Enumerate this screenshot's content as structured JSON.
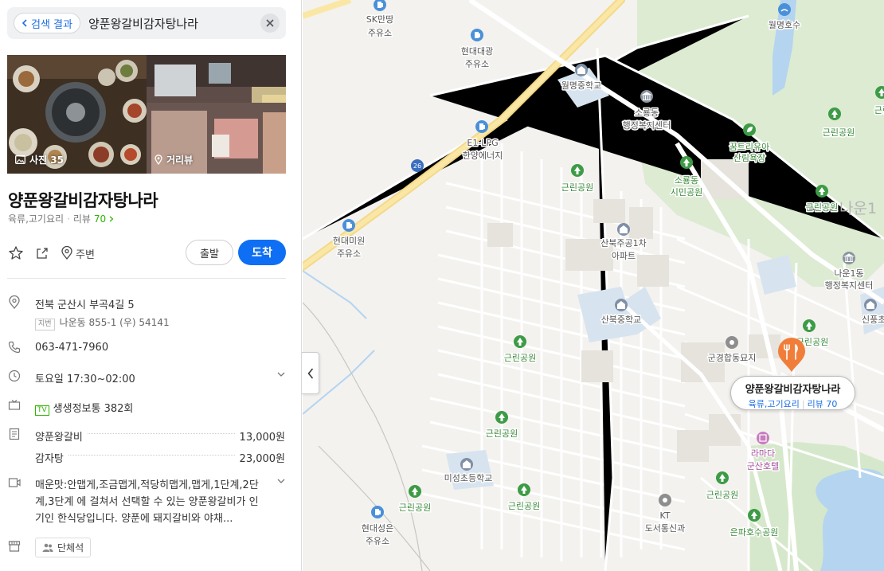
{
  "search": {
    "back_label": "검색 결과",
    "query": "양푼왕갈비감자탕나라"
  },
  "photos": {
    "photo_label": "사진 35",
    "street_label": "거리뷰"
  },
  "place": {
    "name": "양푼왕갈비감자탕나라",
    "category": "육류,고기요리",
    "review_label": "리뷰",
    "review_count": "70",
    "nearby_label": "주변",
    "start_label": "출발",
    "arrive_label": "도착"
  },
  "info": {
    "address": "전북 군산시 부곡4길 5",
    "lot_tag": "지번",
    "lot_address": "나운동 855-1 (우) 54141",
    "phone": "063-471-7960",
    "hours": "토요일 17:30~02:00",
    "tv_tag": "TV",
    "tv_text": "생생정보통 382회",
    "menu": [
      {
        "name": "양푼왕갈비",
        "price": "13,000원"
      },
      {
        "name": "감자탕",
        "price": "23,000원"
      }
    ],
    "description": "매운맛:안맵게,조금맵게,적당히맵게,맵게,1단계,2단계,3단계 에 걸쳐서 선택할 수 있는 양푼왕갈비가 인기인 한식당입니다. 양푼에 돼지갈비와 야채...",
    "facility": "단체석"
  },
  "map": {
    "labels": {
      "sk": [
        "SK만땅",
        "주유소"
      ],
      "hyundai_daegwang": [
        "현대대광",
        "주유소"
      ],
      "wolmyeong_lake": "월명호수",
      "wolmyeong_ms": "월명중학교",
      "sorong_office": [
        "소룡동",
        "행정복지센터"
      ],
      "e1": [
        "E1-LPG",
        "한양에너지"
      ],
      "park": "근린공원",
      "dream_forest": [
        "꿈트리유아",
        "산림욕장"
      ],
      "sorong_park": [
        "소룡동",
        "시민공원"
      ],
      "hyundai_mi": [
        "현대미원",
        "주유소"
      ],
      "sanbuk_apt": [
        "산북주공1차",
        "아파트"
      ],
      "naun1_office": [
        "나운1동",
        "행정복지센터"
      ],
      "sanbuk_ms": "산북중학교",
      "sinpung": "신풍초등학",
      "cemetery": "군경합동묘지",
      "ramada": [
        "라마다",
        "군산호텔"
      ],
      "misung": "미성초등학교",
      "hyundai_seong": [
        "현대성은",
        "주유소"
      ],
      "kt": [
        "KT",
        "도서통신과"
      ],
      "eunpa": "은파호수공원",
      "naun_area": "나운1",
      "route_no": "26"
    },
    "callout": {
      "name": "양푼왕갈비감자탕나라",
      "category": "육류,고기요리",
      "review": "리뷰 70"
    }
  },
  "colors": {
    "accent": "#0e6ff4",
    "review_green": "#2db400",
    "marker": "#f07e3a",
    "park": "#cfe6c5",
    "water": "#b4d4f0"
  }
}
